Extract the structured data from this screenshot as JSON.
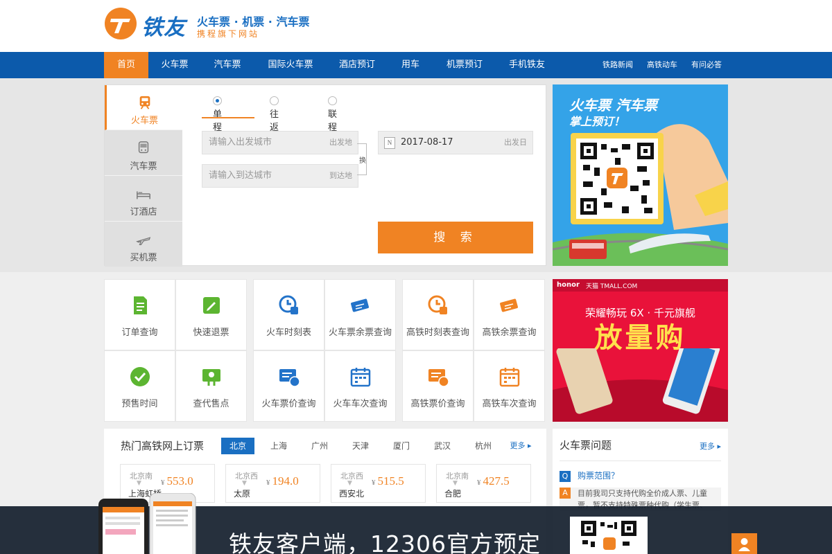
{
  "brand": {
    "name": "铁友",
    "slogan": "火车票 · 机票 · 汽车票",
    "subslogan": "携程旗下网站"
  },
  "nav": {
    "items": [
      "首页",
      "火车票",
      "汽车票",
      "国际火车票",
      "酒店预订",
      "用车",
      "机票预订",
      "手机铁友"
    ],
    "right": [
      "铁路新闻",
      "高铁动车",
      "有问必答"
    ]
  },
  "search": {
    "tabs": [
      "火车票",
      "汽车票",
      "订酒店",
      "买机票"
    ],
    "trip_types": [
      "单程",
      "往返",
      "联程"
    ],
    "from": {
      "placeholder": "请输入出发城市",
      "tag": "出发地"
    },
    "to": {
      "placeholder": "请输入到达城市",
      "tag": "到达地"
    },
    "swap": "换",
    "date": {
      "value": "2017-08-17",
      "tag": "出发日",
      "icon_text": "N"
    },
    "button": "搜 索"
  },
  "ad_qr": {
    "line1": "火车票 汽车票",
    "line2": "掌上预订！"
  },
  "quick": [
    {
      "label": "订单查询",
      "icon": "doc-icon"
    },
    {
      "label": "快速退票",
      "icon": "edit-icon"
    },
    {
      "label": "火车时刻表",
      "icon": "clock-train-icon"
    },
    {
      "label": "火车票余票查询",
      "icon": "ticket-icon"
    },
    {
      "label": "高铁时刻表查询",
      "icon": "clock-train-icon"
    },
    {
      "label": "高铁余票查询",
      "icon": "ticket-icon"
    },
    {
      "label": "预售时间",
      "icon": "check-circle-icon"
    },
    {
      "label": "查代售点",
      "icon": "map-icon"
    },
    {
      "label": "火车票价查询",
      "icon": "price-icon"
    },
    {
      "label": "火车车次查询",
      "icon": "calendar-icon"
    },
    {
      "label": "高铁票价查询",
      "icon": "price-icon"
    },
    {
      "label": "高铁车次查询",
      "icon": "calendar-icon"
    }
  ],
  "ad_honor": {
    "brand": "honor",
    "mall": "天猫 TMALL.COM",
    "headline": "荣耀畅玩 6X · 千元旗舰",
    "big": "放量购"
  },
  "hot": {
    "title": "热门高铁网上订票",
    "cities": [
      "北京",
      "上海",
      "广州",
      "天津",
      "厦门",
      "武汉",
      "杭州"
    ],
    "more": "更多",
    "routes": [
      {
        "from": "北京南",
        "to": "上海虹桥",
        "price": "553.0"
      },
      {
        "from": "北京西",
        "to": "太原",
        "price": "194.0"
      },
      {
        "from": "北京西",
        "to": "西安北",
        "price": "515.5"
      },
      {
        "from": "北京南",
        "to": "合肥",
        "price": "427.5"
      }
    ],
    "currency": "¥"
  },
  "faq": {
    "title": "火车票问题",
    "more": "更多",
    "q": "购票范围？",
    "a1": "目前我司只支持代购全价成人票、儿童",
    "a2": "票，暂不支持特殊票种代购（学生票、",
    "q_badge": "Q",
    "a_badge": "A"
  },
  "bottom": {
    "text": "铁友客户端，12306官方预定"
  },
  "colors": {
    "brand_blue": "#0c5aab",
    "accent_orange": "#f08323",
    "link_blue": "#1a6fc2",
    "green_icon": "#5cb531"
  }
}
